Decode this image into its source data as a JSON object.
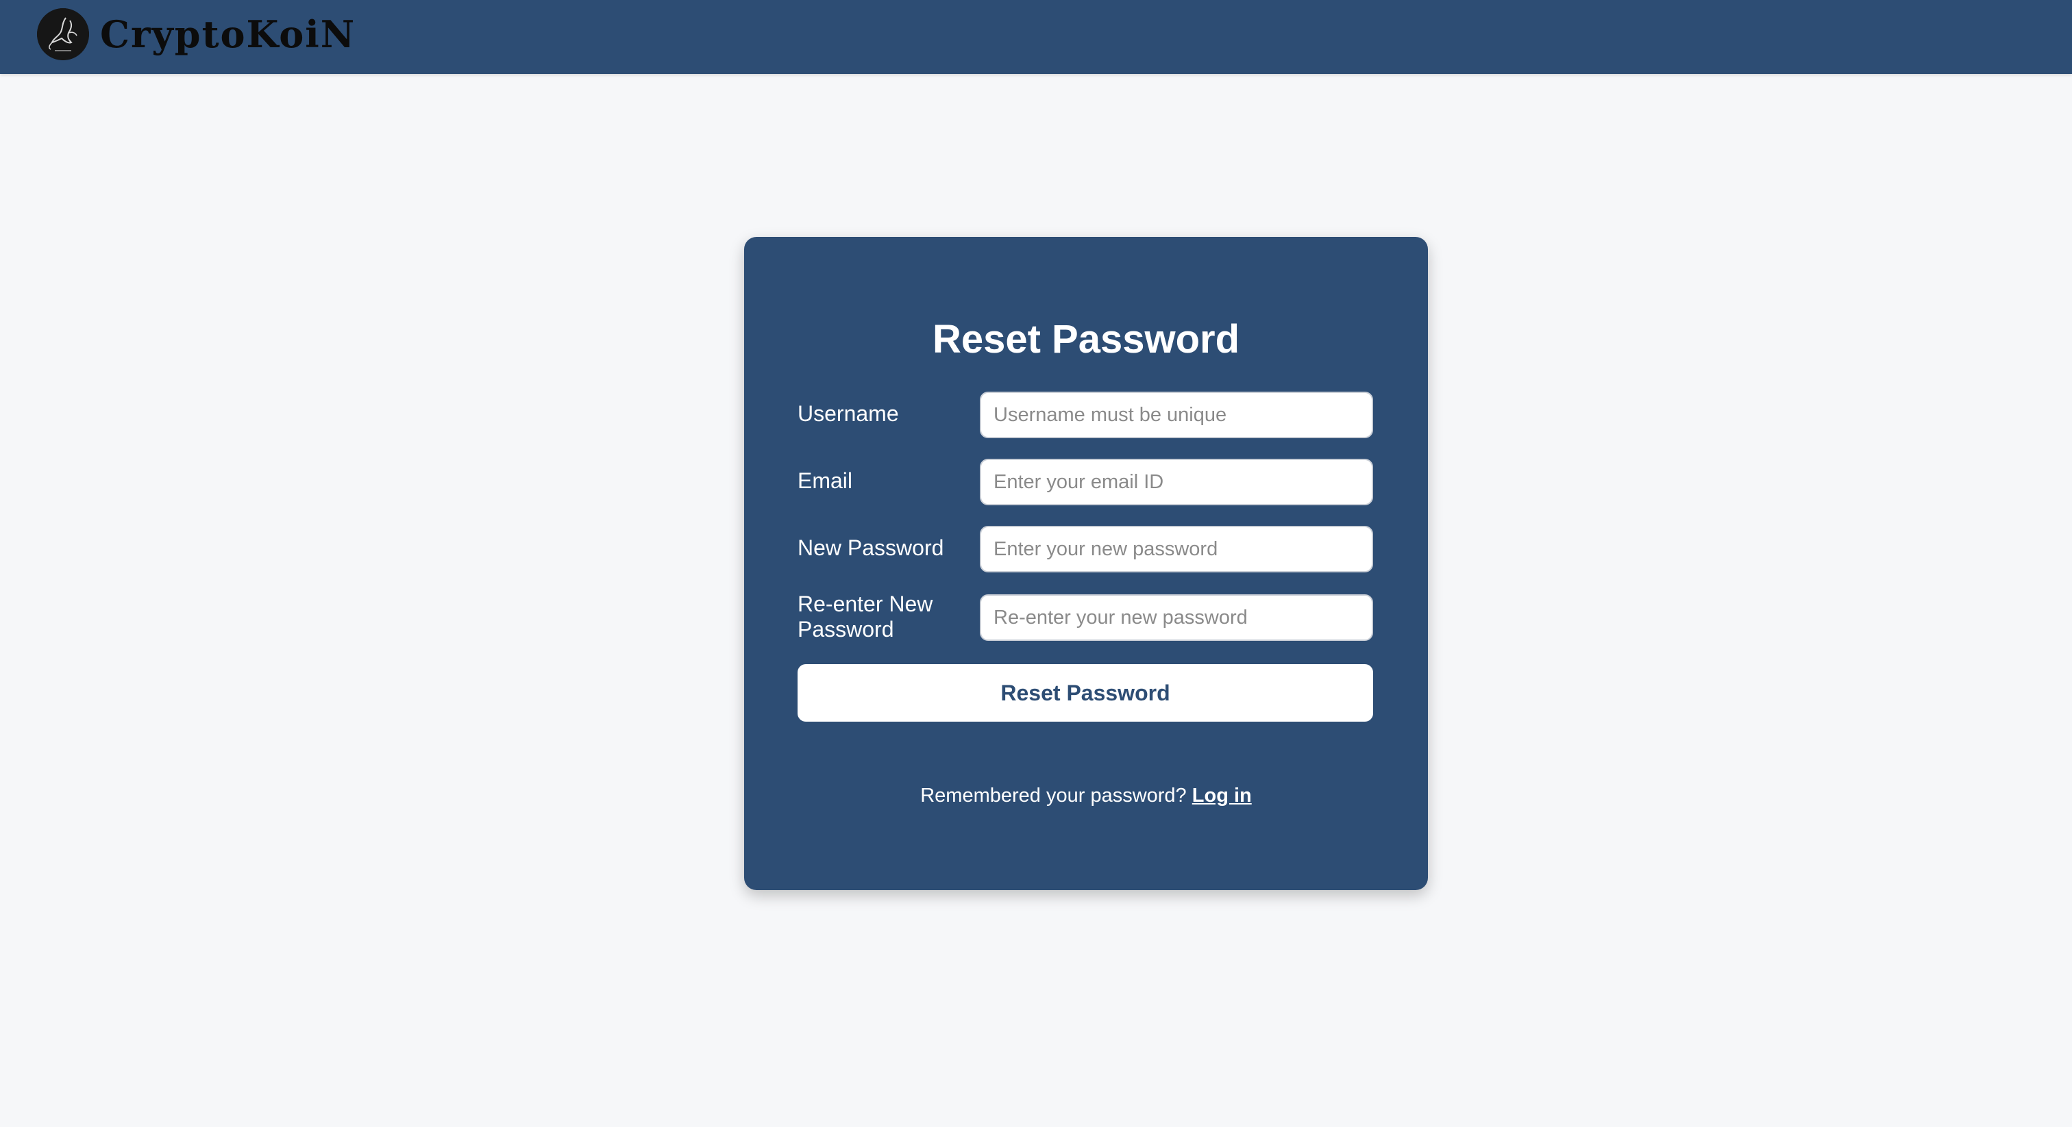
{
  "brand": {
    "name": "CryptoKoiN",
    "logo_icon": "koi-fish-logo-icon"
  },
  "colors": {
    "navbar": "#2d4d74",
    "card": "#2d4d74",
    "background": "#f6f7f9",
    "button_text": "#2d4d74"
  },
  "form": {
    "title": "Reset Password",
    "fields": {
      "username": {
        "label": "Username",
        "placeholder": "Username must be unique",
        "value": ""
      },
      "email": {
        "label": "Email",
        "placeholder": "Enter your email ID",
        "value": ""
      },
      "new_password": {
        "label": "New Password",
        "placeholder": "Enter your new password",
        "value": ""
      },
      "confirm_password": {
        "label": "Re-enter New Password",
        "placeholder": "Re-enter your new password",
        "value": ""
      }
    },
    "submit_label": "Reset Password",
    "footer": {
      "prompt": "Remembered your password?",
      "link_label": "Log in"
    }
  }
}
